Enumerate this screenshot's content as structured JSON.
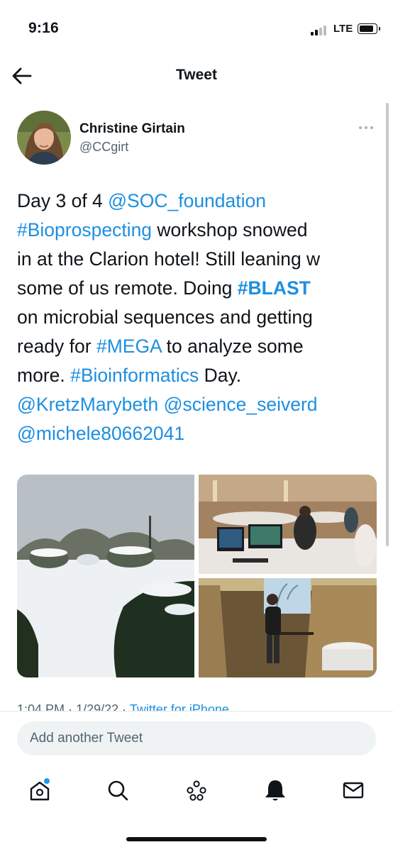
{
  "status_bar": {
    "time": "9:16",
    "network": "LTE"
  },
  "header": {
    "title": "Tweet"
  },
  "tweet": {
    "author": {
      "name": "Christine Girtain",
      "handle": "@CCgirt"
    },
    "text_lines": [
      [
        {
          "t": "Day 3 of 4 ",
          "k": "text"
        },
        {
          "t": "@SOC_foundation",
          "k": "link"
        }
      ],
      [
        {
          "t": "#Bioprospecting",
          "k": "link"
        },
        {
          "t": " workshop snowed",
          "k": "text"
        }
      ],
      [
        {
          "t": "in at the Clarion hotel! Still leaning w",
          "k": "text"
        }
      ],
      [
        {
          "t": "some of us remote. Doing ",
          "k": "text"
        },
        {
          "t": "#BLAST",
          "k": "bold-link"
        }
      ],
      [
        {
          "t": "on microbial sequences and getting",
          "k": "text"
        }
      ],
      [
        {
          "t": "ready for ",
          "k": "text"
        },
        {
          "t": "#MEGA",
          "k": "link"
        },
        {
          "t": " to analyze some",
          "k": "text"
        }
      ],
      [
        {
          "t": "more. ",
          "k": "text"
        },
        {
          "t": "#Bioinformatics",
          "k": "link"
        },
        {
          "t": " Day.",
          "k": "text"
        }
      ],
      [
        {
          "t": "@KretzMarybeth",
          "k": "link"
        },
        {
          "t": " ",
          "k": "text"
        },
        {
          "t": "@science_seiverd",
          "k": "link"
        }
      ],
      [
        {
          "t": "@michele80662041",
          "k": "link"
        }
      ]
    ],
    "meta": {
      "time": "1:04 PM",
      "sep": "·",
      "date": "1/29/22",
      "source": "Twitter for iPhone"
    },
    "photos": [
      {
        "name": "snowy-parking-lot-photo"
      },
      {
        "name": "workshop-computers-photo"
      },
      {
        "name": "presenter-screen-photo"
      }
    ]
  },
  "compose": {
    "placeholder": "Add another Tweet"
  },
  "tabbar": {
    "items": [
      {
        "name": "home-tab",
        "icon": "home-icon",
        "has_notification_dot": true
      },
      {
        "name": "search-tab",
        "icon": "search-icon"
      },
      {
        "name": "spaces-tab",
        "icon": "spaces-icon"
      },
      {
        "name": "notifications-tab",
        "icon": "bell-icon"
      },
      {
        "name": "messages-tab",
        "icon": "mail-icon"
      }
    ]
  },
  "colors": {
    "accent": "#1d9bf0",
    "text": "#0f1419",
    "secondary": "#536471"
  }
}
